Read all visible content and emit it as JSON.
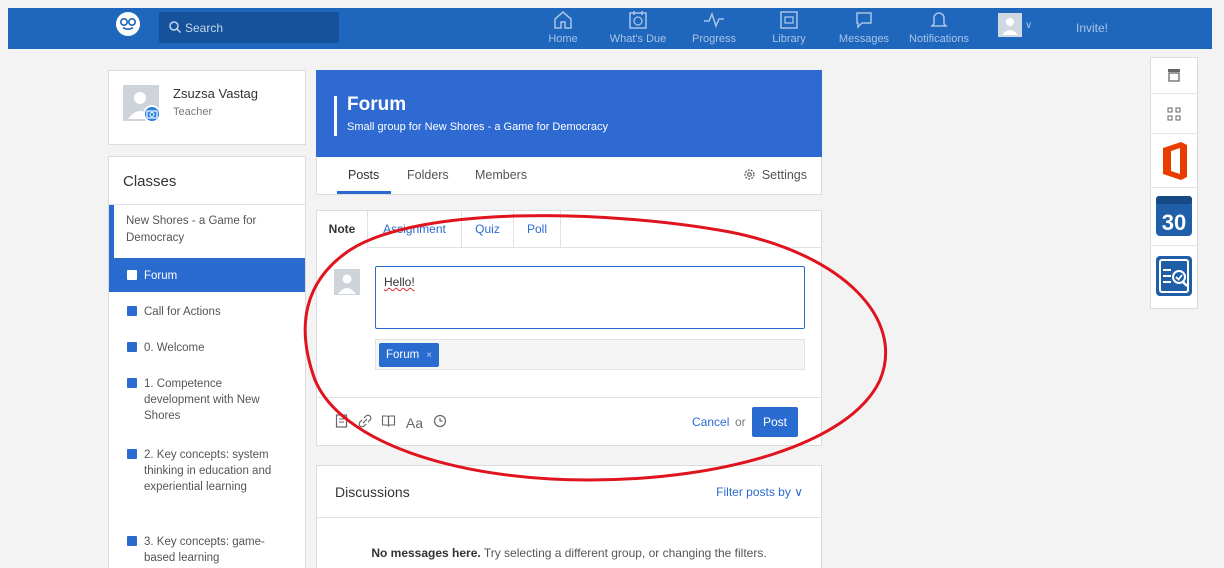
{
  "nav": {
    "search_placeholder": "Search",
    "items": [
      {
        "label": "Home",
        "icon": "home-icon"
      },
      {
        "label": "What's Due",
        "icon": "calendar-check-icon"
      },
      {
        "label": "Progress",
        "icon": "pulse-icon"
      },
      {
        "label": "Library",
        "icon": "library-icon"
      },
      {
        "label": "Messages",
        "icon": "chat-icon"
      },
      {
        "label": "Notifications",
        "icon": "bell-icon"
      }
    ],
    "invite_label": "Invite!"
  },
  "profile": {
    "name": "Zsuzsa Vastag",
    "role": "Teacher"
  },
  "sidebar": {
    "classes_title": "Classes",
    "current_class": "New Shores - a Game for Democracy",
    "groups": [
      {
        "label": "Forum"
      },
      {
        "label": "Call for Actions"
      },
      {
        "label": "0. Welcome"
      },
      {
        "label": "1. Competence development with New Shores"
      },
      {
        "label": "2. Key concepts: system thinking in education and experiential learning"
      },
      {
        "label": "3. Key concepts: game-based learning"
      }
    ]
  },
  "forum": {
    "title": "Forum",
    "subtitle": "Small group for New Shores - a Game for Democracy",
    "tabs": [
      "Posts",
      "Folders",
      "Members"
    ],
    "settings_label": "Settings"
  },
  "composer": {
    "tabs": [
      "Note",
      "Assignment",
      "Quiz",
      "Poll"
    ],
    "text": "Hello!",
    "recipient": "Forum",
    "recipient_remove": "×",
    "tool_text": "Aa",
    "cancel_label": "Cancel",
    "or_label": "or",
    "post_label": "Post"
  },
  "discussions": {
    "title": "Discussions",
    "filter_label": "Filter posts by",
    "empty_bold": "No messages here.",
    "empty_rest": " Try selecting a different group, or changing the filters."
  },
  "rail": {
    "calendar_number": "30"
  },
  "colors": {
    "brand": "#1f66bd",
    "accent": "#2a6bd0",
    "annotation": "#e0141e",
    "office": "#eb3c00"
  }
}
